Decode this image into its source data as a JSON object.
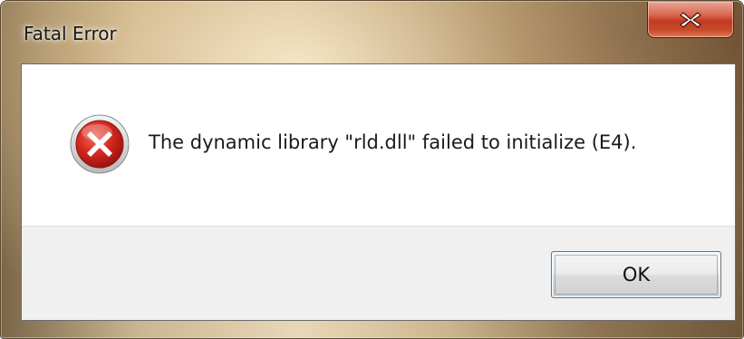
{
  "window": {
    "title": "Fatal Error",
    "close_icon": "close-icon"
  },
  "message": {
    "icon": "error-icon",
    "text": "The dynamic library \"rld.dll\" failed to initialize (E4)."
  },
  "buttons": {
    "ok_label": "OK"
  },
  "colors": {
    "close_button": "#c7432a",
    "error_icon": "#c8201c",
    "button_area": "#f0f0f0"
  }
}
